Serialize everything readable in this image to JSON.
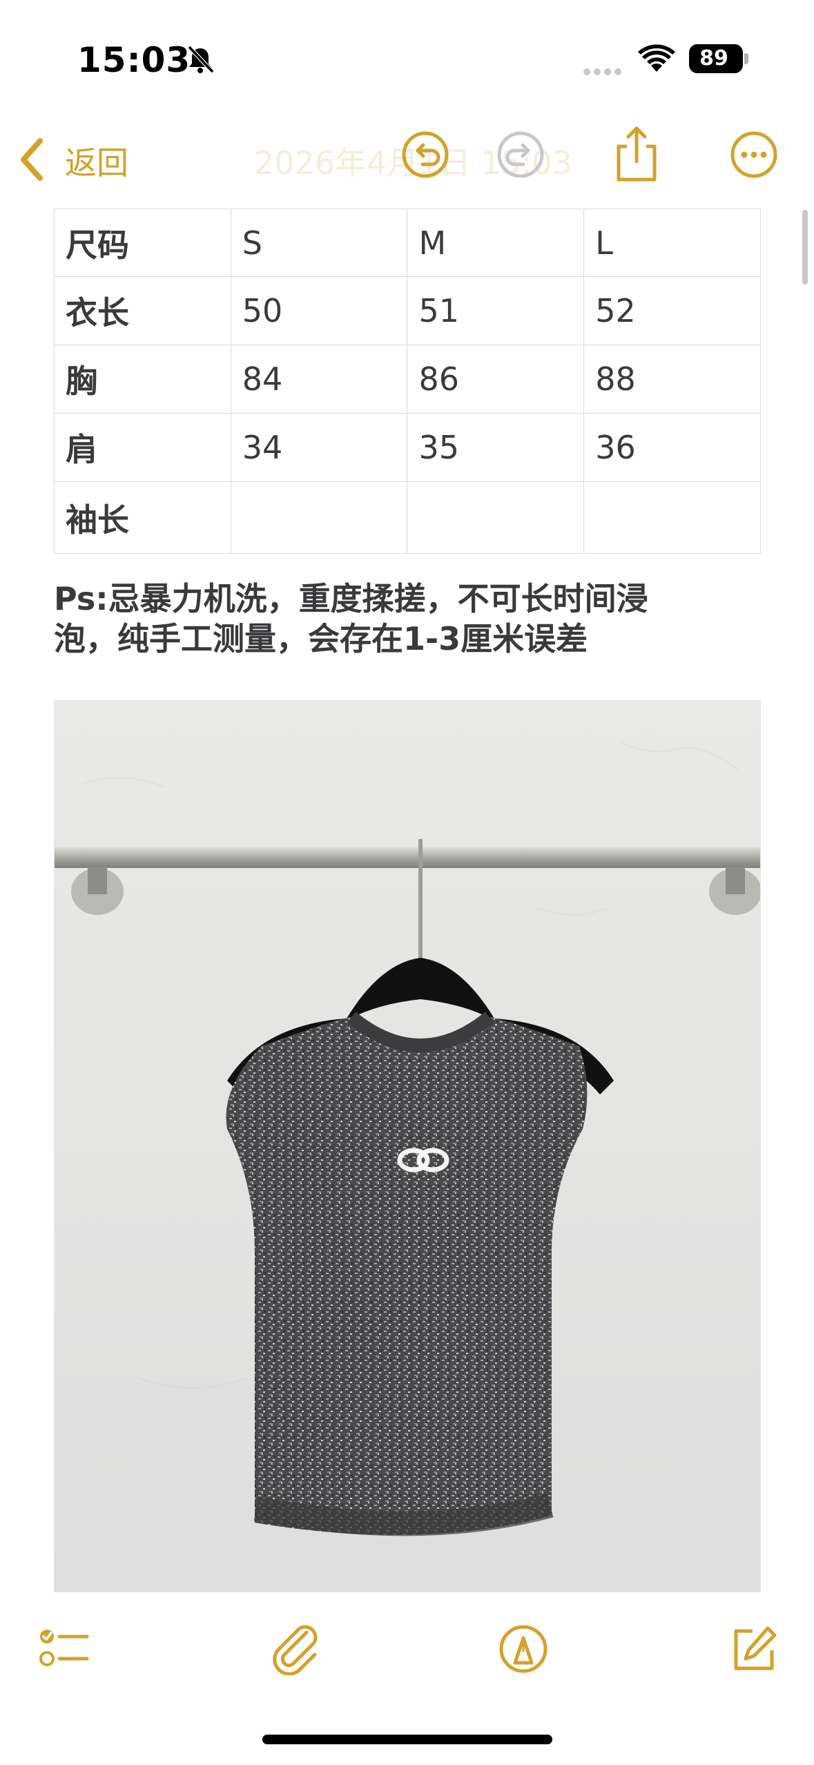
{
  "status_bar": {
    "time": "15:03",
    "battery": "89",
    "icons": [
      "bell-slash-icon",
      "cellular-icon",
      "wifi-icon",
      "battery-icon"
    ]
  },
  "nav": {
    "back_label": "返回",
    "title_faded": "2026年4月1日 15:03",
    "icons": [
      "chevron-left-icon",
      "undo-icon",
      "redo-icon",
      "share-icon",
      "more-icon"
    ]
  },
  "size_table": {
    "header": [
      "尺码",
      "S",
      "M",
      "L"
    ],
    "rows": [
      [
        "衣长",
        "50",
        "51",
        "52"
      ],
      [
        "胸",
        "84",
        "86",
        "88"
      ],
      [
        "肩",
        "34",
        "35",
        "36"
      ],
      [
        "袖长",
        "",
        "",
        ""
      ]
    ]
  },
  "note": {
    "line1": "Ps:忌暴力机洗，重度揉搓，不可长时间浸",
    "line2": "泡，纯手工测量，会存在1-3厘米误差"
  },
  "photo": {
    "subject": "sleeveless-knit-top-photo"
  },
  "toolbar": {
    "icons": [
      "checklist-icon",
      "paperclip-icon",
      "markup-pen-icon",
      "compose-icon"
    ]
  },
  "colors": {
    "accent": "#d4a12a",
    "text": "#3a3a3c",
    "grid": "#dcdcdc"
  }
}
